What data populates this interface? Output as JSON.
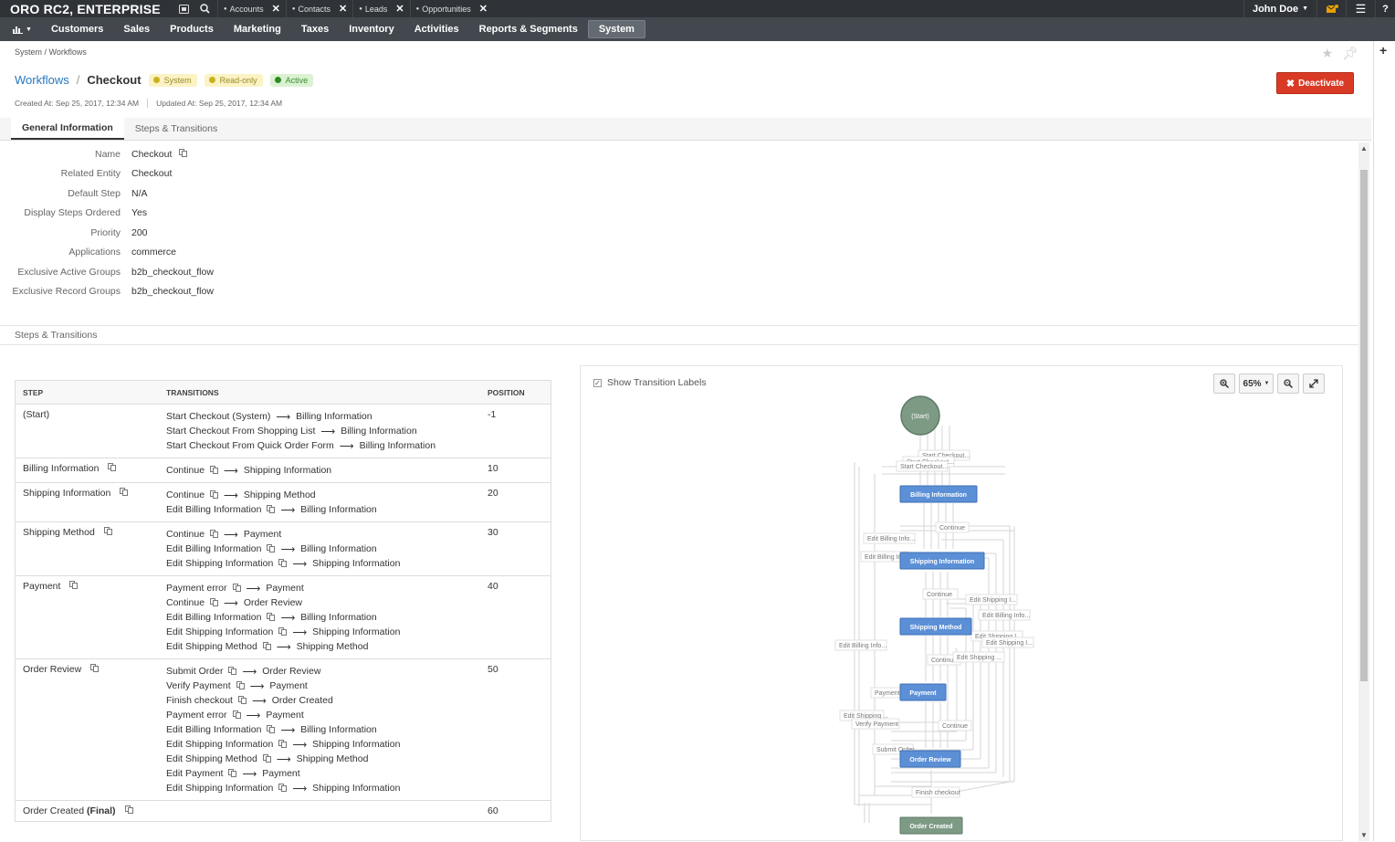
{
  "app": {
    "brand": "ORO RC2, ENTERPRISE"
  },
  "pinned_tabs": [
    {
      "label": "Accounts"
    },
    {
      "label": "Contacts"
    },
    {
      "label": "Leads"
    },
    {
      "label": "Opportunities"
    }
  ],
  "user": {
    "name": "John Doe"
  },
  "menu": [
    "Customers",
    "Sales",
    "Products",
    "Marketing",
    "Taxes",
    "Inventory",
    "Activities",
    "Reports & Segments",
    "System"
  ],
  "breadcrumb": "System / Workflows",
  "title": {
    "parent": "Workflows",
    "current": "Checkout"
  },
  "badges": [
    {
      "label": "System",
      "color": "#c9b21e"
    },
    {
      "label": "Read-only",
      "color": "#c9b21e"
    },
    {
      "label": "Active",
      "color": "#2f8a22"
    }
  ],
  "deactivate_label": "Deactivate",
  "meta": {
    "created": "Created At: Sep 25, 2017, 12:34 AM",
    "updated": "Updated At: Sep 25, 2017, 12:34 AM"
  },
  "tabs": [
    "General Information",
    "Steps & Transitions"
  ],
  "general": [
    {
      "label": "Name",
      "value": "Checkout"
    },
    {
      "label": "Related Entity",
      "value": "Checkout"
    },
    {
      "label": "Default Step",
      "value": "N/A"
    },
    {
      "label": "Display Steps Ordered",
      "value": "Yes"
    },
    {
      "label": "Priority",
      "value": "200"
    },
    {
      "label": "Applications",
      "value": "commerce"
    },
    {
      "label": "Exclusive Active Groups",
      "value": "b2b_checkout_flow"
    },
    {
      "label": "Exclusive Record Groups",
      "value": "b2b_checkout_flow"
    }
  ],
  "section_title": "Steps & Transitions",
  "table": {
    "headers": [
      "STEP",
      "TRANSITIONS",
      "POSITION"
    ],
    "rows": [
      {
        "step": "(Start)",
        "final": "",
        "trans_icon": false,
        "position": "-1",
        "transitions": [
          {
            "name": "Start Checkout (System)",
            "to": "Billing Information",
            "icon": false
          },
          {
            "name": "Start Checkout From Shopping List",
            "to": "Billing Information",
            "icon": false
          },
          {
            "name": "Start Checkout From Quick Order Form",
            "to": "Billing Information",
            "icon": false
          }
        ]
      },
      {
        "step": "Billing Information",
        "final": "",
        "trans_icon": true,
        "position": "10",
        "transitions": [
          {
            "name": "Continue",
            "to": "Shipping Information",
            "icon": true
          }
        ]
      },
      {
        "step": "Shipping Information",
        "final": "",
        "trans_icon": true,
        "position": "20",
        "transitions": [
          {
            "name": "Continue",
            "to": "Shipping Method",
            "icon": true
          },
          {
            "name": "Edit Billing Information",
            "to": "Billing Information",
            "icon": true
          }
        ]
      },
      {
        "step": "Shipping Method",
        "final": "",
        "trans_icon": true,
        "position": "30",
        "transitions": [
          {
            "name": "Continue",
            "to": "Payment",
            "icon": true
          },
          {
            "name": "Edit Billing Information",
            "to": "Billing Information",
            "icon": true
          },
          {
            "name": "Edit Shipping Information",
            "to": "Shipping Information",
            "icon": true
          }
        ]
      },
      {
        "step": "Payment",
        "final": "",
        "trans_icon": true,
        "position": "40",
        "transitions": [
          {
            "name": "Payment error",
            "to": "Payment",
            "icon": true
          },
          {
            "name": "Continue",
            "to": "Order Review",
            "icon": true
          },
          {
            "name": "Edit Billing Information",
            "to": "Billing Information",
            "icon": true
          },
          {
            "name": "Edit Shipping Information",
            "to": "Shipping Information",
            "icon": true
          },
          {
            "name": "Edit Shipping Method",
            "to": "Shipping Method",
            "icon": true
          }
        ]
      },
      {
        "step": "Order Review",
        "final": "",
        "trans_icon": true,
        "position": "50",
        "transitions": [
          {
            "name": "Submit Order",
            "to": "Order Review",
            "icon": true
          },
          {
            "name": "Verify Payment",
            "to": "Payment",
            "icon": true
          },
          {
            "name": "Finish checkout",
            "to": "Order Created",
            "icon": true
          },
          {
            "name": "Payment error",
            "to": "Payment",
            "icon": true
          },
          {
            "name": "Edit Billing Information",
            "to": "Billing Information",
            "icon": true
          },
          {
            "name": "Edit Shipping Information",
            "to": "Shipping Information",
            "icon": true
          },
          {
            "name": "Edit Shipping Method",
            "to": "Shipping Method",
            "icon": true
          },
          {
            "name": "Edit Payment",
            "to": "Payment",
            "icon": true
          },
          {
            "name": "Edit Shipping Information",
            "to": "Shipping Information",
            "icon": true
          }
        ]
      },
      {
        "step": "Order Created",
        "final": "(Final)",
        "trans_icon": true,
        "position": "60",
        "transitions": []
      }
    ]
  },
  "graph": {
    "show_labels": "Show Transition Labels",
    "zoom": "65%",
    "nodes": [
      {
        "label": "(Start)",
        "kind": "start"
      },
      {
        "label": "Billing Information",
        "kind": "step"
      },
      {
        "label": "Shipping Information",
        "kind": "step"
      },
      {
        "label": "Shipping Method",
        "kind": "step"
      },
      {
        "label": "Payment",
        "kind": "step"
      },
      {
        "label": "Order Review",
        "kind": "step"
      },
      {
        "label": "Order Created",
        "kind": "final"
      }
    ],
    "edge_labels": [
      "Start Checkout...",
      "Start Checkout...",
      "Start Checkout...",
      "Continue",
      "Edit Billing Info...",
      "Edit Billing Info...",
      "Continue",
      "Edit Shipping I...",
      "Edit Billing Info...",
      "Edit Billing Info...",
      "Edit Shipping I...",
      "Edit Shipping I...",
      "Continue",
      "Edit Shipping ...",
      "Payment error",
      "Edit Shipping ...",
      "Verify Payment",
      "Continue",
      "Submit Order",
      "Finish checkout"
    ]
  }
}
